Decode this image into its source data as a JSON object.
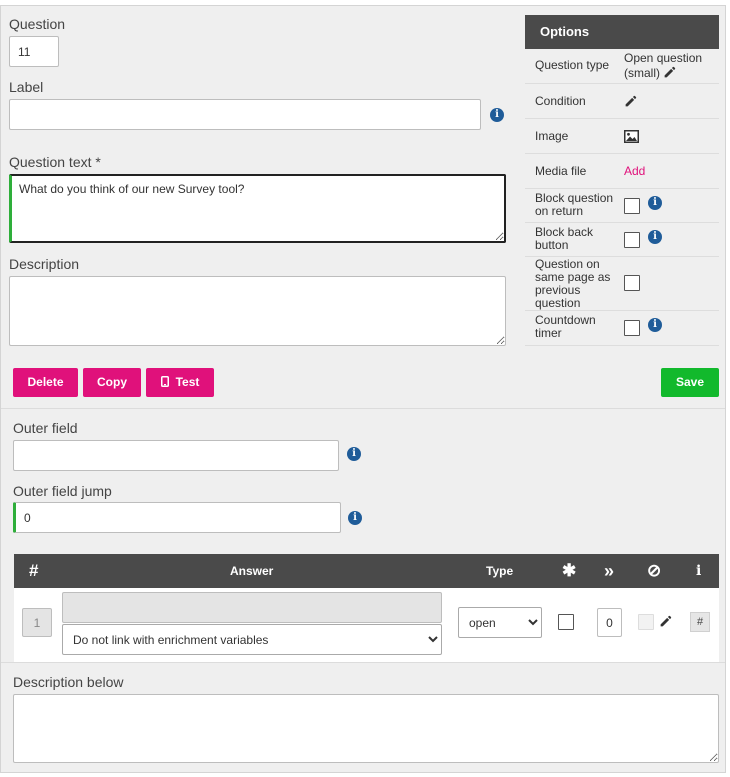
{
  "question": {
    "label": "Question",
    "number": "11"
  },
  "label_field": {
    "label": "Label",
    "value": ""
  },
  "question_text": {
    "label": "Question text *",
    "value": "What do you think of our new Survey tool?"
  },
  "description": {
    "label": "Description",
    "value": ""
  },
  "options": {
    "title": "Options",
    "question_type_label": "Question type",
    "question_type_value": "Open question (small)",
    "condition_label": "Condition",
    "image_label": "Image",
    "media_file_label": "Media file",
    "media_file_link": "Add",
    "block_return_label": "Block question on return",
    "block_back_label": "Block back button",
    "same_page_label": "Question on same page as previous question",
    "countdown_label": "Countdown timer"
  },
  "buttons": {
    "delete": "Delete",
    "copy": "Copy",
    "test": "Test",
    "save": "Save"
  },
  "outer_field": {
    "label": "Outer field",
    "value": ""
  },
  "outer_field_jump": {
    "label": "Outer field jump",
    "value": "0"
  },
  "answers_table": {
    "headers": {
      "number": "#",
      "answer": "Answer",
      "type": "Type",
      "required": "✱",
      "jump": "»",
      "exclusive": "⊘",
      "info": "i"
    },
    "rows": [
      {
        "number": "1",
        "answer_text": "",
        "enrichment": "Do not link with enrichment variables",
        "type": "open",
        "jump": "0",
        "hash": "#"
      }
    ]
  },
  "description_below": {
    "label": "Description below",
    "value": ""
  },
  "colors": {
    "primary": "#e0117b",
    "save": "#12b92c",
    "header": "#4a4a4a",
    "info": "#1f5c99"
  }
}
